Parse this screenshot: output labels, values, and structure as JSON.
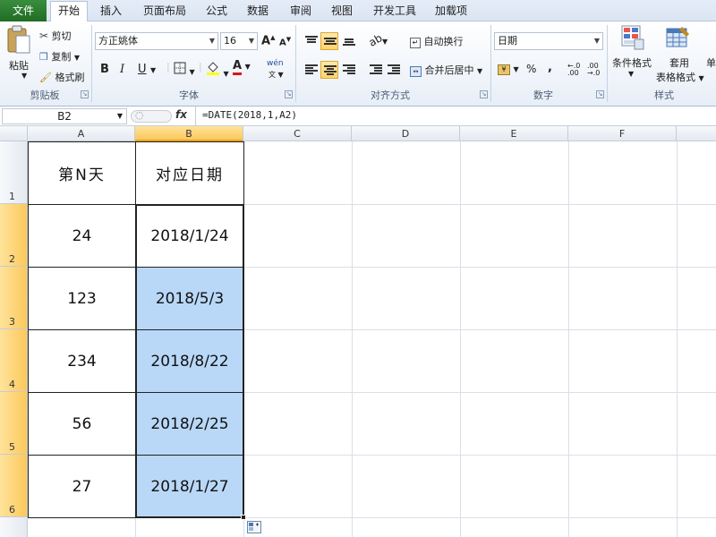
{
  "tabs": [
    "文件",
    "开始",
    "插入",
    "页面布局",
    "公式",
    "数据",
    "审阅",
    "视图",
    "开发工具",
    "加载项"
  ],
  "clipboard": {
    "paste": "粘贴",
    "cut": "剪切",
    "copy": "复制",
    "format_painter": "格式刷",
    "group": "剪贴板"
  },
  "font": {
    "name": "方正姚体",
    "size": "16",
    "bold": "B",
    "italic": "I",
    "underline": "U",
    "grow": "A",
    "shrink": "A",
    "color_letter": "A",
    "phonetic": "wén",
    "group": "字体"
  },
  "alignment": {
    "wrap": "自动换行",
    "merge": "合并后居中",
    "group": "对齐方式"
  },
  "number": {
    "format": "日期",
    "percent": "%",
    "comma": ",",
    "group": "数字"
  },
  "styles": {
    "conditional": "条件格式",
    "table_line1": "套用",
    "table_line2": "表格格式",
    "cell_styles": "单",
    "group": "样式"
  },
  "formula_bar": {
    "name_box": "B2",
    "fx": "fx",
    "formula": "=DATE(2018,1,A2)"
  },
  "columns": [
    "A",
    "B",
    "C",
    "D",
    "E",
    "F"
  ],
  "rows": [
    "1",
    "2",
    "3",
    "4",
    "5",
    "6"
  ],
  "table": {
    "header": [
      "第N天",
      "对应日期"
    ],
    "rows": [
      [
        "24",
        "2018/1/24"
      ],
      [
        "123",
        "2018/5/3"
      ],
      [
        "234",
        "2018/8/22"
      ],
      [
        "56",
        "2018/2/25"
      ],
      [
        "27",
        "2018/1/27"
      ]
    ]
  },
  "colors": {
    "file_tab": "#2a7d2f",
    "selection_fill": "#b9d8f8",
    "header_selected": "#fcc85a"
  }
}
